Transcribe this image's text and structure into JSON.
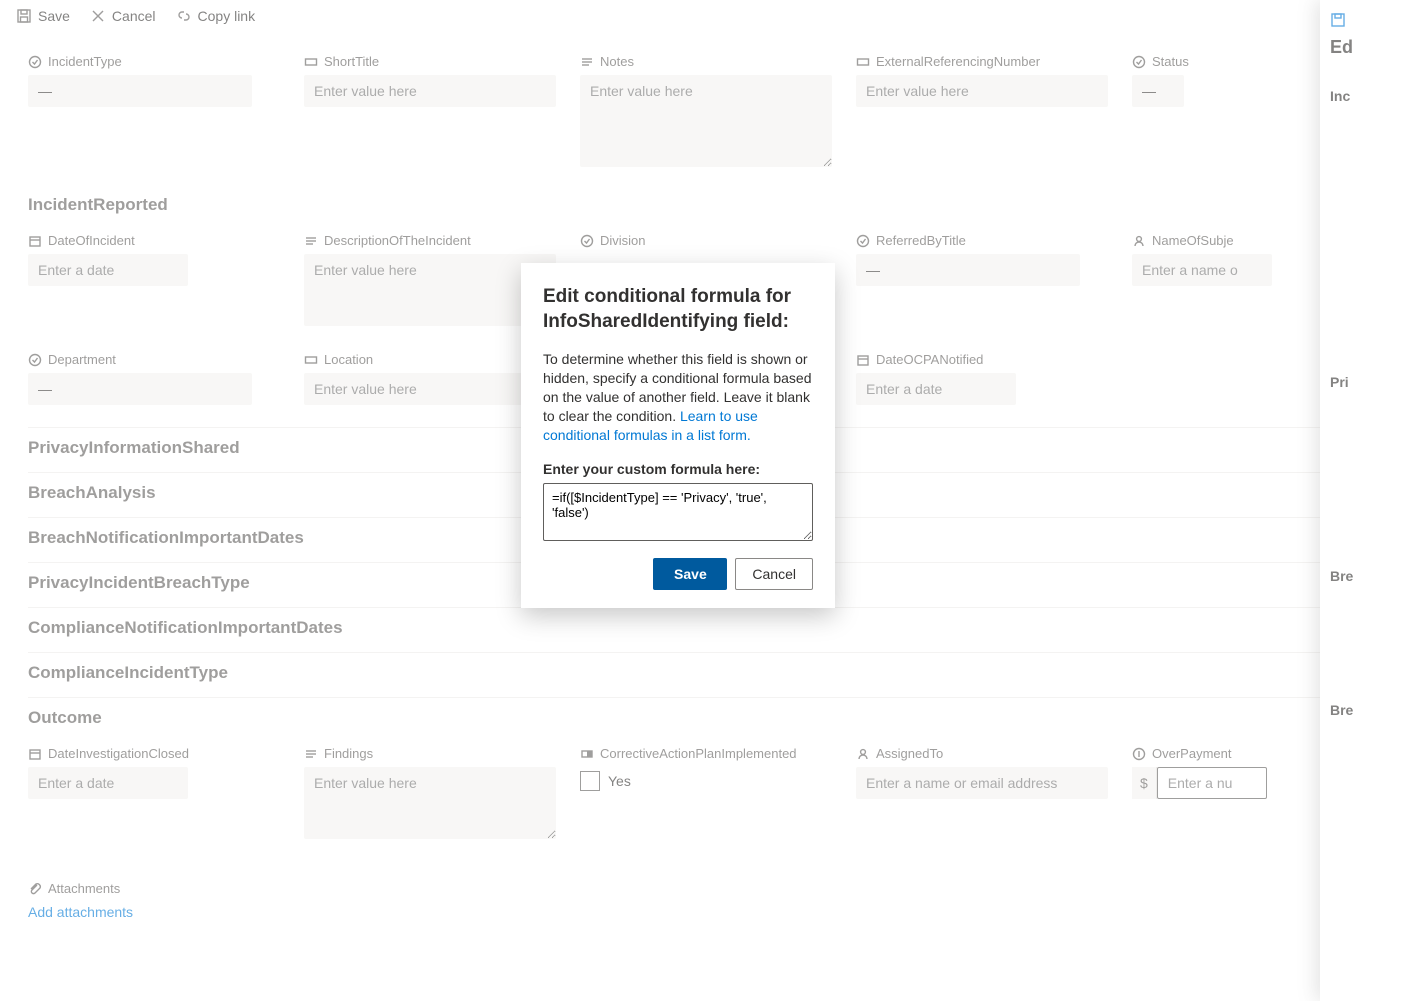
{
  "cmdbar": {
    "save": "Save",
    "cancel": "Cancel",
    "copylink": "Copy link"
  },
  "placeholders": {
    "text": "Enter value here",
    "date": "Enter a date",
    "person": "Enter a name or email address",
    "number": "Enter a nu",
    "name_or": "Enter a name o"
  },
  "dash": "—",
  "dollar": "$",
  "topFields": {
    "incidentType": "IncidentType",
    "shortTitle": "ShortTitle",
    "notes": "Notes",
    "externalRef": "ExternalReferencingNumber",
    "status": "Status"
  },
  "sections": {
    "incidentReported": "IncidentReported",
    "privacyInfoShared": "PrivacyInformationShared",
    "breachAnalysis": "BreachAnalysis",
    "breachNotifDates": "BreachNotificationImportantDates",
    "privacyBreachType": "PrivacyIncidentBreachType",
    "complianceNotifDates": "ComplianceNotificationImportantDates",
    "complianceIncidentType": "ComplianceIncidentType",
    "outcome": "Outcome"
  },
  "incidentReported": {
    "dateOfIncident": "DateOfIncident",
    "description": "DescriptionOfTheIncident",
    "division": "Division",
    "referredByTitle": "ReferredByTitle",
    "nameOfSubject": "NameOfSubje",
    "department": "Department",
    "location": "Location",
    "dateOCPANotified": "DateOCPANotified"
  },
  "outcome": {
    "dateInvestigationClosed": "DateInvestigationClosed",
    "findings": "Findings",
    "correctiveAction": "CorrectiveActionPlanImplemented",
    "yes": "Yes",
    "assignedTo": "AssignedTo",
    "overPayment": "OverPayment"
  },
  "attachments": {
    "label": "Attachments",
    "add": "Add attachments"
  },
  "rightPanel": {
    "heading": "Ed",
    "sec1": "Inc",
    "sec2": "Pri",
    "sec3": "Bre",
    "sec4": "Bre"
  },
  "modal": {
    "title": "Edit conditional formula for InfoSharedIdentifying field:",
    "desc": "To determine whether this field is shown or hidden, specify a conditional formula based on the value of another field. Leave it blank to clear the condition.",
    "link": "Learn to use conditional formulas in a list form.",
    "inputLabel": "Enter your custom formula here:",
    "formula": "=if([$IncidentType] == 'Privacy', 'true', 'false')",
    "save": "Save",
    "cancel": "Cancel"
  }
}
